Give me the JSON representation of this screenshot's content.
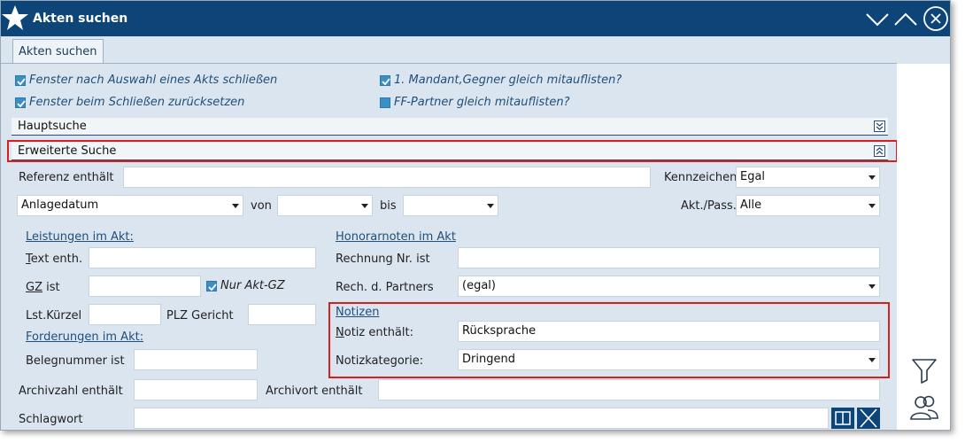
{
  "window": {
    "title": "Akten suchen"
  },
  "tabs": [
    {
      "label": "Akten suchen"
    }
  ],
  "options": {
    "close_after_select": "Fenster nach Auswahl eines Akts schließen",
    "reset_on_close": "Fenster beim Schließen zurücksetzen",
    "list_mandant_gegner": "1. Mandant,Gegner gleich mitauflisten?",
    "list_ff_partner": "FF-Partner gleich mitauflisten?"
  },
  "sections": {
    "hauptsuche": "Hauptsuche",
    "erweiterte": "Erweiterte Suche"
  },
  "form": {
    "referenz_label": "Referenz enthält",
    "referenz_value": "",
    "kennzeichen_label": "Kennzeichen",
    "kennzeichen_value": "Egal",
    "date_field_value": "Anlagedatum",
    "von_label": "von",
    "von_value": "",
    "bis_label": "bis",
    "bis_value": "",
    "aktpass_label": "Akt./Pass.",
    "aktpass_value": "Alle",
    "leistungen_header": "Leistungen im Akt:",
    "text_enth_label_first": "T",
    "text_enth_label_rest": "ext enth.",
    "text_enth_value": "",
    "gz_label_first": "GZ",
    "gz_label_rest": " ist",
    "gz_value": "",
    "nur_akt_gz_label": "Nur Akt-GZ",
    "lst_kuerzel_label": "Lst.Kürzel",
    "lst_kuerzel_value": "",
    "plz_gericht_label": "PLZ Gericht",
    "plz_gericht_value": "",
    "forderungen_header": "Forderungen im Akt:",
    "belegnummer_label": "Belegnummer ist",
    "belegnummer_value": "",
    "archivzahl_label": "Archivzahl enthält",
    "archivzahl_value": "",
    "archivort_label": "Archivort enthält",
    "archivort_value": "",
    "schlagwort_label": "Schlagwort",
    "schlagwort_value": "",
    "honorarnoten_header": "Honorarnoten im Akt",
    "rechnung_label": "Rechnung Nr. ist",
    "rechnung_value": "",
    "rech_partners_label": "Rech. d. Partners",
    "rech_partners_value": "(egal)",
    "notizen_header": "Notizen",
    "notiz_label_first": "N",
    "notiz_label_rest": "otiz enthält:",
    "notiz_value": "Rücksprache",
    "notizkategorie_label": "Notizkategorie:",
    "notizkategorie_value": "Dringend"
  },
  "colors": {
    "titlebar": "#0e4578",
    "background": "#dbe5ef",
    "checkbox": "#3a8fc7",
    "highlight": "#d81f1f"
  },
  "icons": [
    "star-icon",
    "chevron-down-icon",
    "chevron-up-icon",
    "close-icon",
    "filter-icon",
    "users-icon",
    "book-icon",
    "clear-icon"
  ]
}
